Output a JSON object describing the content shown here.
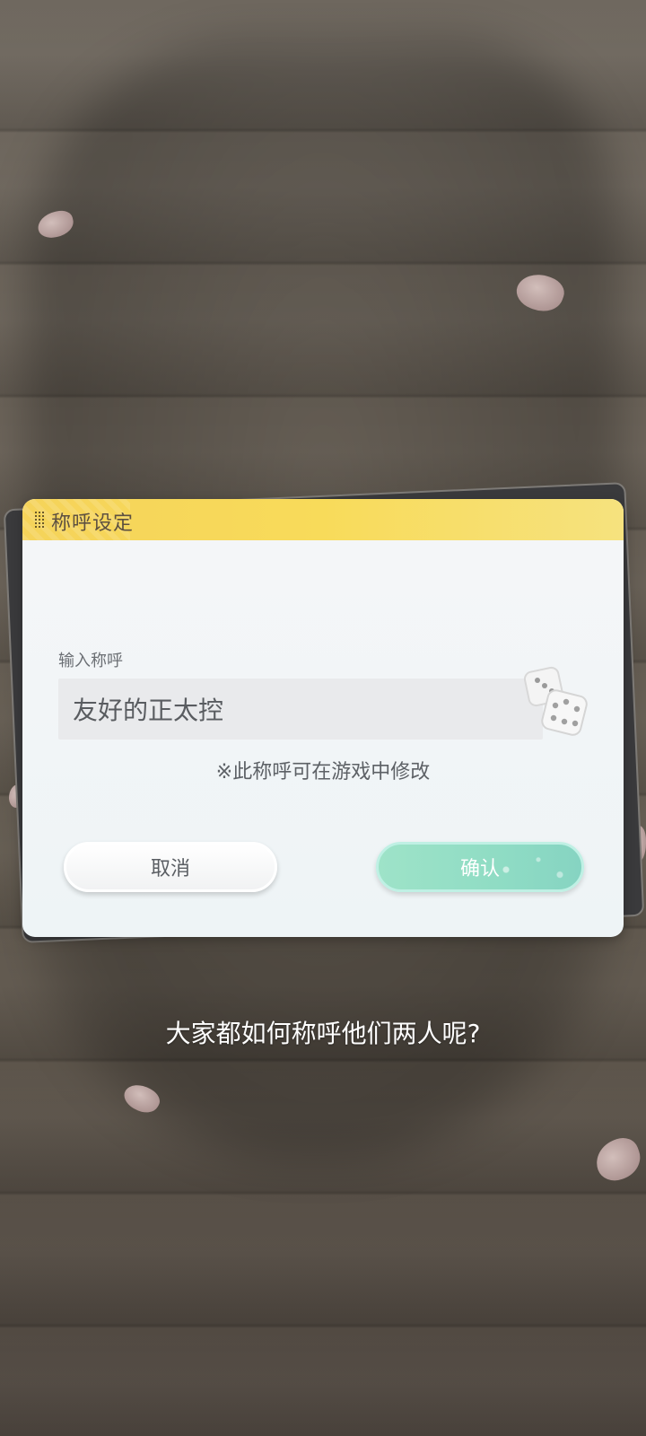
{
  "dialog": {
    "title": "称呼设定",
    "input_label": "输入称呼",
    "input_value": "友好的正太控",
    "hint": "※此称呼可在游戏中修改",
    "cancel_label": "取消",
    "confirm_label": "确认"
  },
  "question": "大家都如何称呼他们两人呢?",
  "colors": {
    "header": "#f8db5a",
    "confirm": "#8fdcc4",
    "background": "#6a6258"
  }
}
